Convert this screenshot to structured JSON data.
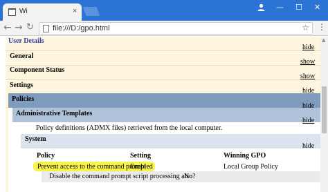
{
  "browser": {
    "tab_title": "Wi",
    "tab_close": "×",
    "url": "file:///D:/gpo.html",
    "icons": {
      "back": "back-arrow-icon",
      "forward": "forward-arrow-icon",
      "reload": "reload-icon",
      "star": "bookmark-star-icon",
      "menu": "menu-dots-icon",
      "profile": "profile-icon"
    },
    "window_controls": {
      "minimize": "—",
      "maximize": "☐",
      "close": "✕"
    }
  },
  "report": {
    "user_details": "User Details",
    "user_details_action": "hide",
    "sections": [
      {
        "title": "General",
        "action": "show"
      },
      {
        "title": "Component Status",
        "action": "show"
      },
      {
        "title": "Settings",
        "action": "hide"
      }
    ],
    "policies": {
      "title": "Policies",
      "action": "hide"
    },
    "admin_templates": {
      "title": "Administrative Templates",
      "action": "hide",
      "description": "Policy definitions (ADMX files) retrieved from the local computer."
    },
    "system": {
      "title": "System",
      "action": "hide"
    },
    "table": {
      "headers": [
        "Policy",
        "Setting",
        "Winning GPO"
      ],
      "row": {
        "policy": "Prevent access to the command prompt",
        "setting": "Enabled",
        "gpo": "Local Group Policy"
      },
      "subrow": {
        "label": "Disable the command prompt script processing also?",
        "value": "No"
      }
    }
  },
  "colors": {
    "titlebar": "#2b73d4",
    "report_band": "#fdf5dd",
    "policies_band": "#7f9cbf",
    "admin_band": "#aec3d9",
    "system_band": "#dbe4ee",
    "highlight": "#f7f34a",
    "link_title": "#2c3fb4"
  }
}
